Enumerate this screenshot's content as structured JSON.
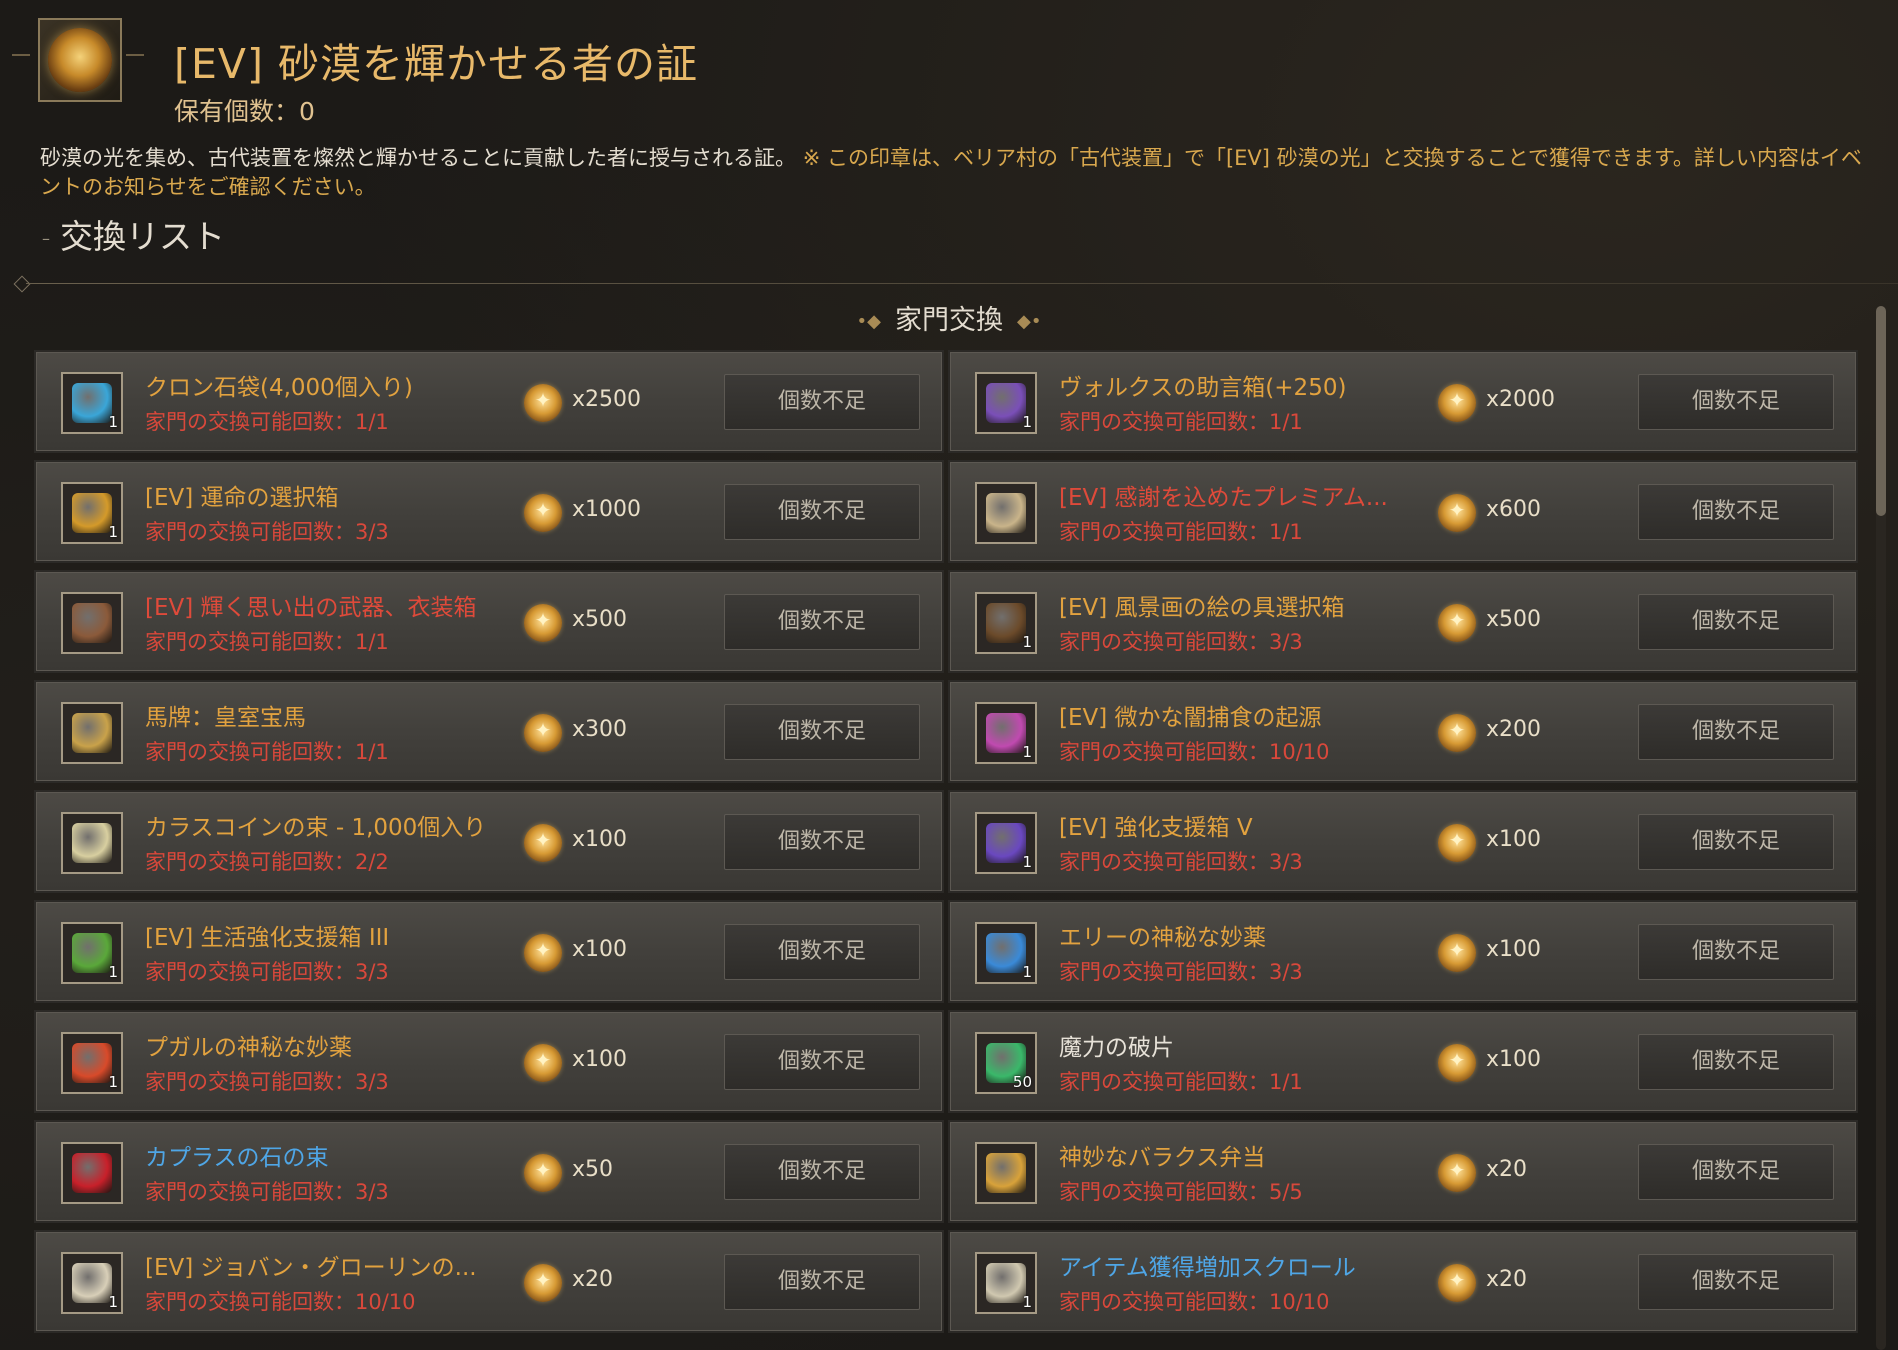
{
  "header": {
    "title": "[EV] 砂漠を輝かせる者の証",
    "owned": "保有個数：0",
    "description_main": "砂漠の光を集め、古代装置を燦然と輝かせることに貢献した者に授与される証。",
    "description_note": "※ この印章は、ベリア村の「古代装置」で「[EV] 砂漠の光」と交換することで獲得できます。詳しい内容はイベントのお知らせをご確認ください。",
    "list_title": "交換リスト",
    "list_dash": "–"
  },
  "section": {
    "title": "家門交換",
    "ornament_left": "•◆",
    "ornament_right": "◆•"
  },
  "colors": {
    "orange": "#e2a23f",
    "red": "#df4a3a",
    "white": "#e7e2d8",
    "blue": "#4fa6e6",
    "limit_red": "#d9483b"
  },
  "items": [
    {
      "name": "クロン石袋(4,000個入り)",
      "name_color": "orange",
      "limit": "家門の交換可能回数：1/1",
      "cost": "x2500",
      "qty": "1",
      "icon": "blue-chest-icon",
      "icon_color": "#3aa6d8",
      "button": "個数不足"
    },
    {
      "name": "ヴォルクスの助言箱(+250)",
      "name_color": "orange",
      "limit": "家門の交換可能回数：1/1",
      "cost": "x2000",
      "qty": "1",
      "icon": "purple-chest-icon",
      "icon_color": "#7a4fb8",
      "button": "個数不足"
    },
    {
      "name": "[EV] 運命の選択箱",
      "name_color": "orange",
      "limit": "家門の交換可能回数：3/3",
      "cost": "x1000",
      "qty": "1",
      "icon": "gold-chest-icon",
      "icon_color": "#d49a2a",
      "button": "個数不足"
    },
    {
      "name": "[EV] 感謝を込めたプレミアム...",
      "name_color": "red",
      "limit": "家門の交換可能回数：1/1",
      "cost": "x600",
      "qty": "",
      "icon": "premium-box-icon",
      "icon_color": "#c9b48a",
      "button": "個数不足"
    },
    {
      "name": "[EV] 輝く思い出の武器、衣装箱",
      "name_color": "red",
      "limit": "家門の交換可能回数：1/1",
      "cost": "x500",
      "qty": "",
      "icon": "wooden-chest-icon",
      "icon_color": "#8b5a3a",
      "button": "個数不足"
    },
    {
      "name": "[EV] 風景画の絵の具選択箱",
      "name_color": "orange",
      "limit": "家門の交換可能回数：3/3",
      "cost": "x500",
      "qty": "1",
      "icon": "paint-box-icon",
      "icon_color": "#6b4a2a",
      "button": "個数不足"
    },
    {
      "name": "馬牌：皇室宝馬",
      "name_color": "orange",
      "limit": "家門の交換可能回数：1/1",
      "cost": "x300",
      "qty": "",
      "icon": "horse-medal-icon",
      "icon_color": "#c9a24a",
      "button": "個数不足"
    },
    {
      "name": "[EV] 微かな闇捕食の起源",
      "name_color": "orange",
      "limit": "家門の交換可能回数：10/10",
      "cost": "x200",
      "qty": "1",
      "icon": "spiral-orb-icon",
      "icon_color": "#c04ab0",
      "button": "個数不足"
    },
    {
      "name": "カラスコインの束 - 1,000個入り",
      "name_color": "orange",
      "limit": "家門の交換可能回数：2/2",
      "cost": "x100",
      "qty": "",
      "icon": "coin-pouch-icon",
      "icon_color": "#d8cfa0",
      "button": "個数不足"
    },
    {
      "name": "[EV] 強化支援箱 V",
      "name_color": "orange",
      "limit": "家門の交換可能回数：3/3",
      "cost": "x100",
      "qty": "1",
      "icon": "enhance-box-icon",
      "icon_color": "#6a48c0",
      "button": "個数不足"
    },
    {
      "name": "[EV] 生活強化支援箱 III",
      "name_color": "orange",
      "limit": "家門の交換可能回数：3/3",
      "cost": "x100",
      "qty": "1",
      "icon": "life-box-icon",
      "icon_color": "#5aa83a",
      "button": "個数不足"
    },
    {
      "name": "エリーの神秘な妙薬",
      "name_color": "orange",
      "limit": "家門の交換可能回数：3/3",
      "cost": "x100",
      "qty": "1",
      "icon": "blue-potion-icon",
      "icon_color": "#3a8ad8",
      "button": "個数不足"
    },
    {
      "name": "プガルの神秘な妙薬",
      "name_color": "orange",
      "limit": "家門の交換可能回数：3/3",
      "cost": "x100",
      "qty": "1",
      "icon": "red-potion-icon",
      "icon_color": "#d84a2a",
      "button": "個数不足"
    },
    {
      "name": "魔力の破片",
      "name_color": "white",
      "limit": "家門の交換可能回数：1/1",
      "cost": "x100",
      "qty": "50",
      "icon": "green-shard-icon",
      "icon_color": "#3ab86a",
      "button": "個数不足"
    },
    {
      "name": "カプラスの石の束",
      "name_color": "blue",
      "limit": "家門の交換可能回数：3/3",
      "cost": "x50",
      "qty": "",
      "icon": "red-stone-icon",
      "icon_color": "#c8202a",
      "button": "個数不足"
    },
    {
      "name": "神妙なバラクス弁当",
      "name_color": "orange",
      "limit": "家門の交換可能回数：5/5",
      "cost": "x20",
      "qty": "",
      "icon": "lunchbox-icon",
      "icon_color": "#d8a23a",
      "button": "個数不足"
    },
    {
      "name": "[EV] ジョバン・グローリンの...",
      "name_color": "orange",
      "limit": "家門の交換可能回数：10/10",
      "cost": "x20",
      "qty": "1",
      "icon": "letter-icon",
      "icon_color": "#d8cfb8",
      "button": "個数不足"
    },
    {
      "name": "アイテム獲得増加スクロール",
      "name_color": "blue",
      "limit": "家門の交換可能回数：10/10",
      "cost": "x20",
      "qty": "1",
      "icon": "scroll-icon",
      "icon_color": "#d0c8b0",
      "button": "個数不足"
    }
  ]
}
